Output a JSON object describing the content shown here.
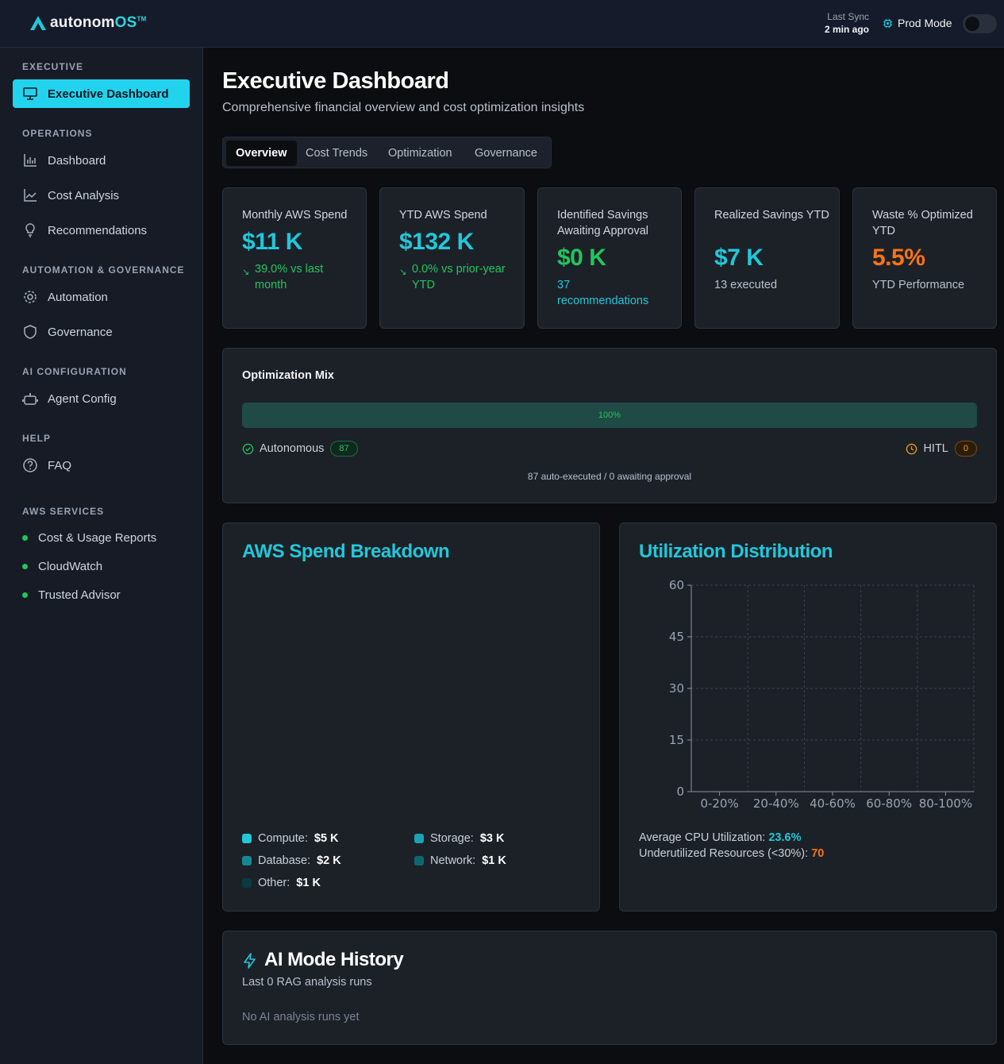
{
  "app": {
    "logo_text": "autonom",
    "logo_os": "OS",
    "logo_tm": "TM",
    "sync_label": "Last Sync",
    "sync_value": "2 min ago",
    "mode_label": "Prod Mode",
    "mode_on": false
  },
  "sidebar": {
    "sections": {
      "executive": "EXECUTIVE",
      "operations": "OPERATIONS",
      "automation": "AUTOMATION & GOVERNANCE",
      "ai": "AI CONFIGURATION",
      "help": "HELP",
      "aws": "AWS SERVICES"
    },
    "items": {
      "executive_dashboard": "Executive Dashboard",
      "dashboard": "Dashboard",
      "cost_analysis": "Cost Analysis",
      "recommendations": "Recommendations",
      "automation": "Automation",
      "governance": "Governance",
      "agent_config": "Agent Config",
      "faq": "FAQ"
    },
    "aws_services": [
      "Cost & Usage Reports",
      "CloudWatch",
      "Trusted Advisor"
    ]
  },
  "page": {
    "title": "Executive Dashboard",
    "subtitle": "Comprehensive financial overview and cost optimization insights",
    "tabs": [
      "Overview",
      "Cost Trends",
      "Optimization",
      "Governance"
    ],
    "active_tab": "Overview"
  },
  "kpis": [
    {
      "title": "Monthly AWS Spend",
      "value": "$11 K",
      "sub": "39.0% vs last month"
    },
    {
      "title": "YTD AWS Spend",
      "value": "$132 K",
      "sub": "0.0% vs prior-year YTD"
    },
    {
      "title": "Identified Savings Awaiting Approval",
      "value": "$0 K",
      "sub": "37 recommendations"
    },
    {
      "title": "Realized Savings YTD",
      "value": "$7 K",
      "sub": "13 executed"
    },
    {
      "title": "Waste % Optimized YTD",
      "value": "5.5%",
      "sub": "YTD Performance"
    }
  ],
  "optimization_mix": {
    "title": "Optimization Mix",
    "bar_label": "100%",
    "autonomous_fraction": 1.0,
    "autonomous_label": "Autonomous",
    "autonomous_count": "87",
    "hitl_label": "HITL",
    "hitl_count": "0",
    "footer": "87 auto-executed / 0 awaiting approval"
  },
  "spend_breakdown": {
    "title": "AWS Spend Breakdown",
    "items": [
      {
        "label": "Compute:",
        "value": "$5 K",
        "color": "#22c7d9"
      },
      {
        "label": "Storage:",
        "value": "$3 K",
        "color": "#1aa3b5"
      },
      {
        "label": "Database:",
        "value": "$2 K",
        "color": "#158894"
      },
      {
        "label": "Network:",
        "value": "$1 K",
        "color": "#106670"
      },
      {
        "label": "Other:",
        "value": "$1 K",
        "color": "#0b3a40"
      }
    ]
  },
  "utilization": {
    "title": "Utilization Distribution",
    "avg_label": "Average CPU Utilization:",
    "avg_value": "23.6%",
    "under_label": "Underutilized Resources (<30%):",
    "under_value": "70"
  },
  "chart_data": {
    "type": "bar",
    "title": "Utilization Distribution",
    "categories": [
      "0-20%",
      "20-40%",
      "40-60%",
      "60-80%",
      "80-100%"
    ],
    "values": [
      0,
      0,
      0,
      0,
      0
    ],
    "y_ticks": [
      "0",
      "15",
      "30",
      "45",
      "60"
    ],
    "ylim": [
      0,
      60
    ],
    "grid": true
  },
  "ai_history": {
    "title": "AI Mode History",
    "subtitle": "Last 0 RAG analysis runs",
    "empty": "No AI analysis runs yet"
  }
}
